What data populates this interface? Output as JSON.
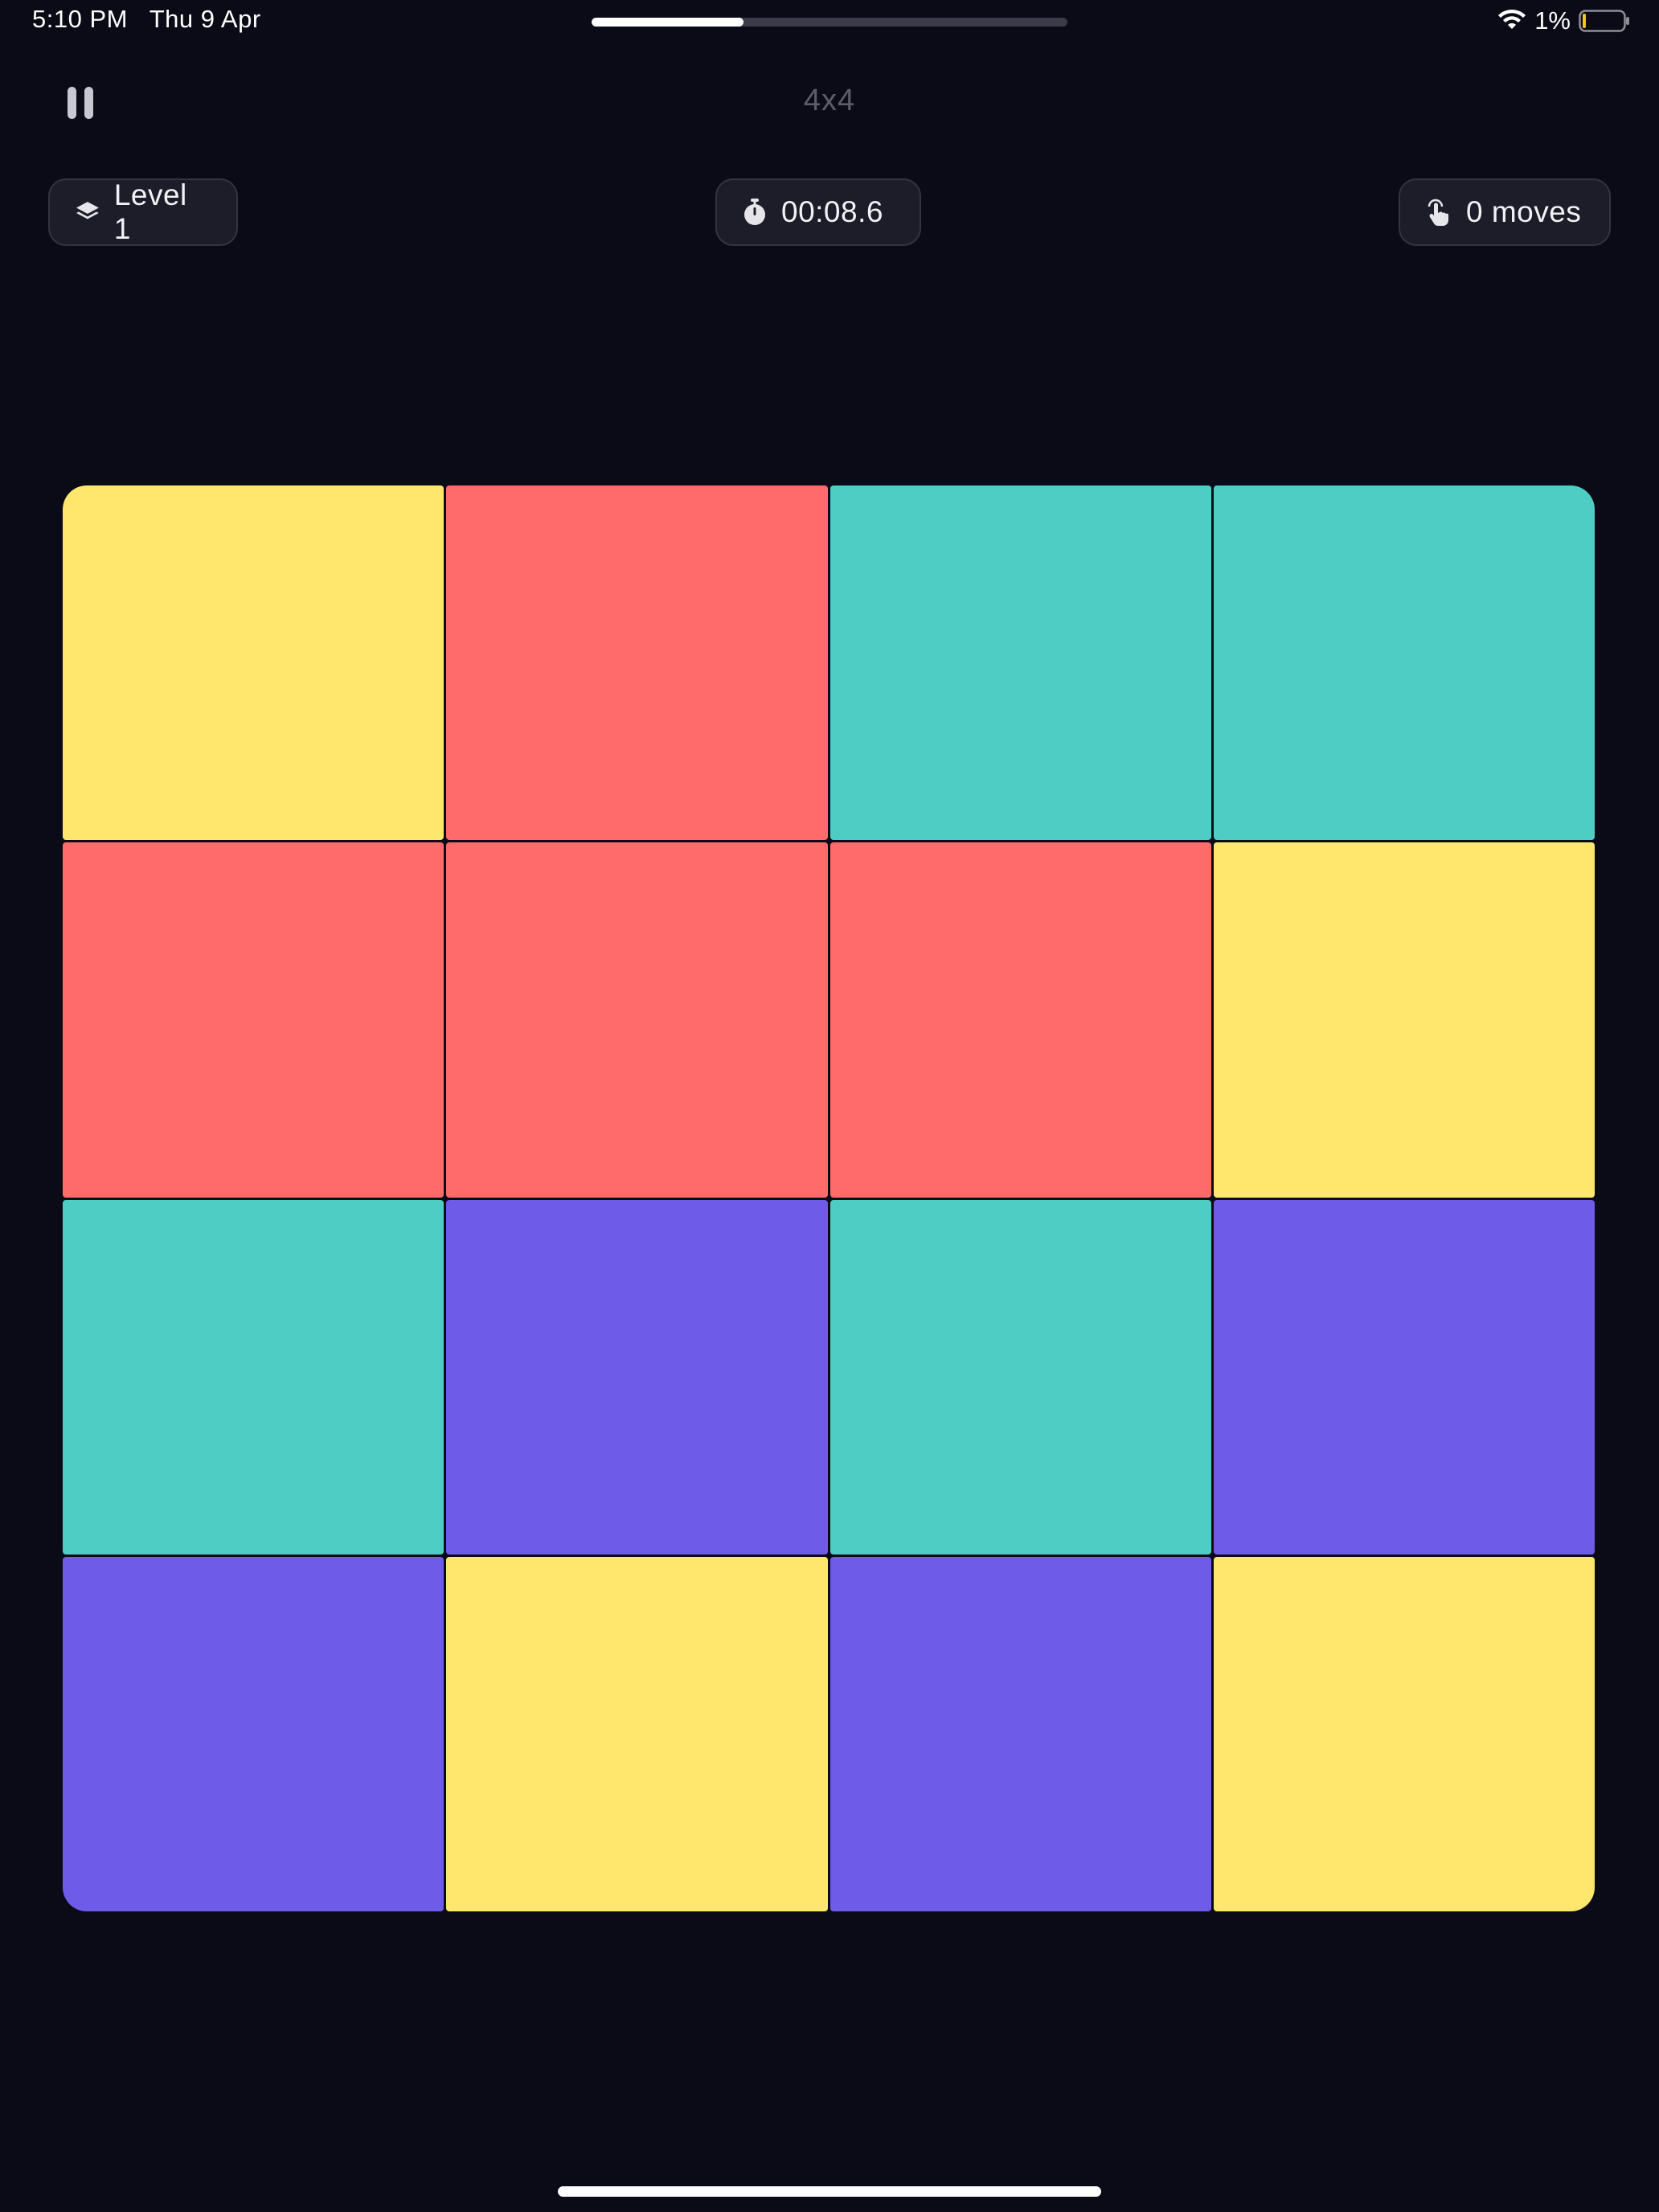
{
  "status_bar": {
    "time": "5:10 PM",
    "date": "Thu 9 Apr",
    "progress": 0.32,
    "battery_percent": "1%",
    "battery_level": 0.01,
    "battery_color": "#f5c518"
  },
  "header": {
    "title": "4x4",
    "pause_icon": "pause-icon"
  },
  "stats": {
    "level": {
      "label": "Level 1",
      "icon": "layers-icon"
    },
    "timer": {
      "label": "00:08.6",
      "icon": "stopwatch-icon"
    },
    "moves": {
      "label": "0 moves",
      "icon": "tap-icon"
    }
  },
  "colors": {
    "yellow": "#ffe66c",
    "red": "#ff6b6b",
    "teal": "#4ecdc4",
    "purple": "#6e5ce8",
    "background": "#0b0b18"
  },
  "board": {
    "rows": 4,
    "cols": 4,
    "tiles": [
      [
        "yellow",
        "red",
        "teal",
        "teal"
      ],
      [
        "red",
        "red",
        "red",
        "yellow"
      ],
      [
        "teal",
        "purple",
        "teal",
        "purple"
      ],
      [
        "purple",
        "yellow",
        "purple",
        "yellow"
      ]
    ]
  }
}
